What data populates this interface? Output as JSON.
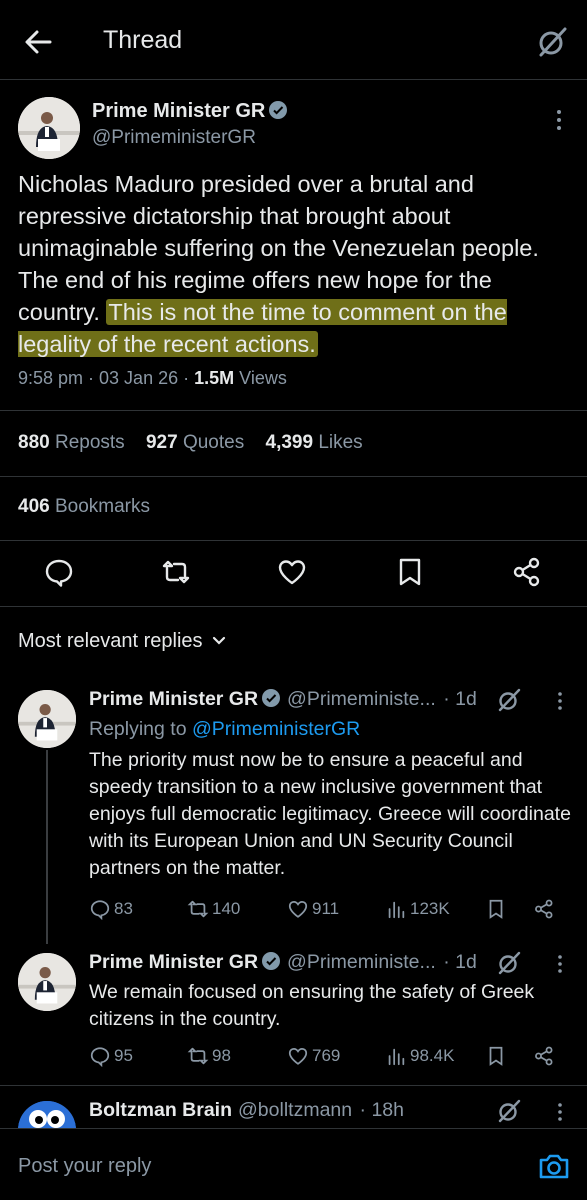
{
  "topbar": {
    "title": "Thread",
    "back_icon": "arrow-left-icon",
    "grok_icon": "grok-icon"
  },
  "main_tweet": {
    "name": "Prime Minister GR",
    "handle": "@PrimeministerGR",
    "text_plain": "Nicholas Maduro presided over a brutal and repressive dictatorship that brought about unimaginable suffering on the Venezuelan people. The end of his regime offers new hope for the country.",
    "text_highlighted": "This is not the time to comment on the legality of the recent actions.",
    "highlight_color": "#6f6f18",
    "time": "9:58 pm · 03 Jan 26 · ",
    "views_count": "1.5M",
    "views_label": " Views",
    "reposts_count": "880",
    "reposts_label": " Reposts",
    "quotes_count": "927",
    "quotes_label": " Quotes",
    "likes_count": "4,399",
    "likes_label": " Likes",
    "bookmarks_count": "406",
    "bookmarks_label": " Bookmarks"
  },
  "sort_label": "Most relevant replies",
  "replies": [
    {
      "name": "Prime Minister GR",
      "handle": "@Primeministe...",
      "time": "· 1d",
      "replying_prefix": "Replying to ",
      "replying_to": "@PrimeministerGR",
      "text": "The priority must now be to ensure a peaceful and speedy transition to a new inclusive government that enjoys full democratic legitimacy. Greece will coordinate with its European Union and UN Security Council partners on the matter.",
      "replies": "83",
      "reposts": "140",
      "likes": "911",
      "views": "123K"
    },
    {
      "name": "Prime Minister GR",
      "handle": "@Primeministe...",
      "time": "· 1d",
      "text": "We remain focused on ensuring the safety of Greek citizens in the country.",
      "replies": "95",
      "reposts": "98",
      "likes": "769",
      "views": "98.4K"
    },
    {
      "name": "Boltzman Brain",
      "handle": "@bolltzmann",
      "time": "· 18h"
    }
  ],
  "reply_bar": {
    "placeholder": "Post your reply",
    "camera_icon": "camera-icon"
  },
  "colors": {
    "accent": "#1d9bf0",
    "muted": "#8b98a5",
    "text": "#e7e9ea",
    "background": "#000000"
  }
}
